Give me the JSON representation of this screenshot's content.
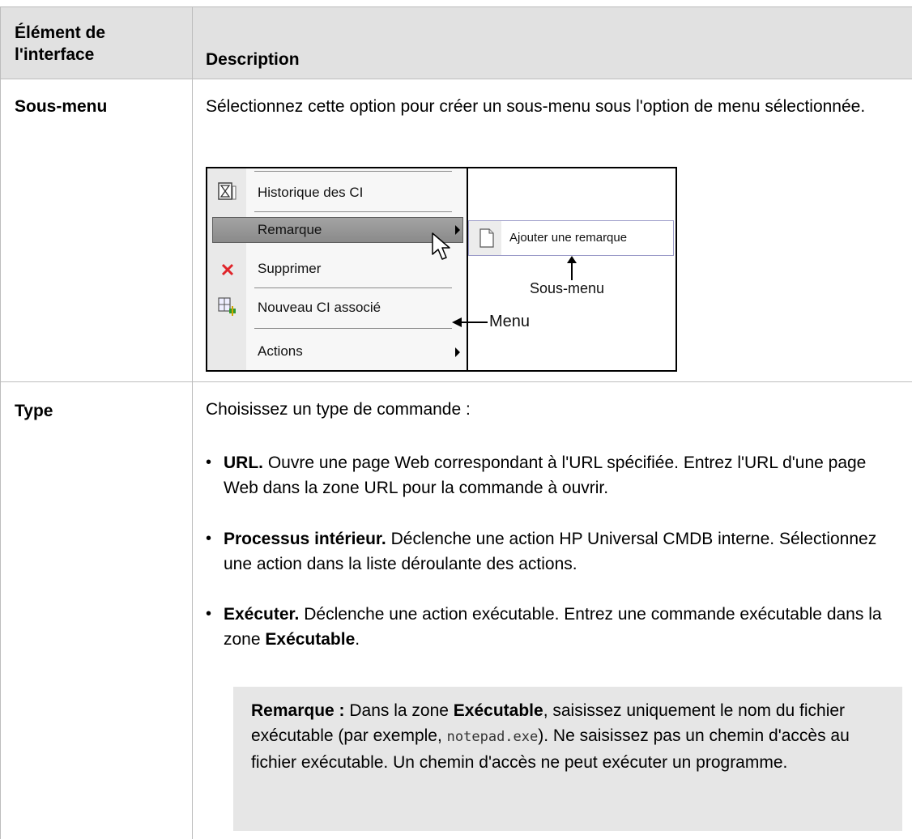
{
  "header": {
    "col1": "Élément de l'interface",
    "col2": "Description"
  },
  "rows": [
    {
      "label": "Sous-menu",
      "description": "Sélectionnez cette option pour créer un sous-menu sous l'option de menu sélectionnée."
    },
    {
      "label": "Type",
      "intro": "Choisissez un type de commande :"
    }
  ],
  "menu_image": {
    "items": [
      "Historique des CI",
      "Remarque",
      "Supprimer",
      "Nouveau CI associé",
      "Actions"
    ],
    "submenu_item": "Ajouter une remarque",
    "annotation_submenu": "Sous-menu",
    "annotation_menu": "Menu"
  },
  "bullets": [
    {
      "term": "URL.",
      "text": "Ouvre une page Web correspondant à l'URL spécifiée. Entrez l'URL d'une page Web dans la zone URL pour la commande à ouvrir."
    },
    {
      "term": "Processus intérieur.",
      "text": "Déclenche une action HP Universal CMDB interne. Sélectionnez une action dans la liste déroulante des actions."
    },
    {
      "term": "Exécuter.",
      "text_before": "Déclenche une action exécutable. Entrez une commande exécutable dans la zone",
      "bold": "Exécutable",
      "text_after": "."
    }
  ],
  "note": {
    "label": "Remarque :",
    "text1": "Dans la zone",
    "bold1": "Exécutable",
    "text2": ", saisissez uniquement le nom du fichier exécutable (par exemple,",
    "code": "notepad.exe",
    "text3": "). Ne saisissez pas un chemin d'accès au fichier exécutable. Un chemin d'accès ne peut exécuter un programme."
  },
  "colors": {
    "header_bg": "#e1e1e1",
    "border": "#bdbdbd",
    "note_bg": "#e6e6e6"
  }
}
